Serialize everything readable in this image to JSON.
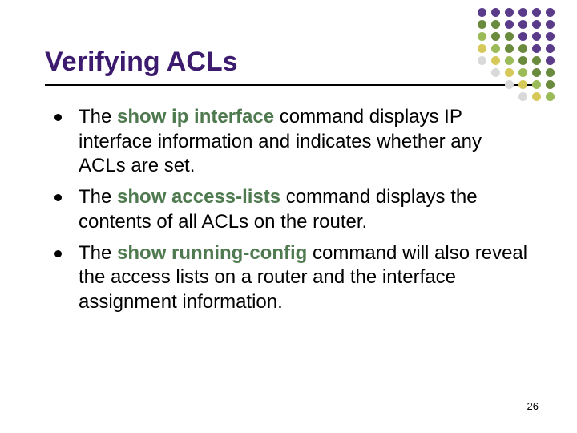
{
  "title": "Verifying ACLs",
  "bullets": [
    {
      "pre": "The ",
      "cmd": "show ip interface",
      "post": " command displays IP interface information and indicates whether any ACLs are set."
    },
    {
      "pre": "The ",
      "cmd": "show access-lists",
      "post": " command displays the contents of all ACLs on the router."
    },
    {
      "pre": "The ",
      "cmd": "show running-config",
      "post": " command will also reveal the access lists on a router and the interface assignment information."
    }
  ],
  "page_number": "26",
  "dot_colors": {
    "purple": "#5a3b8a",
    "green_dark": "#6a8a3d",
    "green_light": "#9bbb59",
    "yellow": "#d6c95a",
    "grey": "#d9d9d9"
  },
  "dot_grid": [
    [
      "purple",
      "purple",
      "purple",
      "purple",
      "purple",
      "purple"
    ],
    [
      "green_dark",
      "green_dark",
      "purple",
      "purple",
      "purple",
      "purple"
    ],
    [
      "green_light",
      "green_dark",
      "green_dark",
      "purple",
      "purple",
      "purple"
    ],
    [
      "yellow",
      "green_light",
      "green_dark",
      "green_dark",
      "purple",
      "purple"
    ],
    [
      "grey",
      "yellow",
      "green_light",
      "green_dark",
      "green_dark",
      "purple"
    ],
    [
      "",
      "grey",
      "yellow",
      "green_light",
      "green_dark",
      "green_dark"
    ],
    [
      "",
      "",
      "grey",
      "yellow",
      "green_light",
      "green_dark"
    ],
    [
      "",
      "",
      "",
      "grey",
      "yellow",
      "green_light"
    ]
  ]
}
